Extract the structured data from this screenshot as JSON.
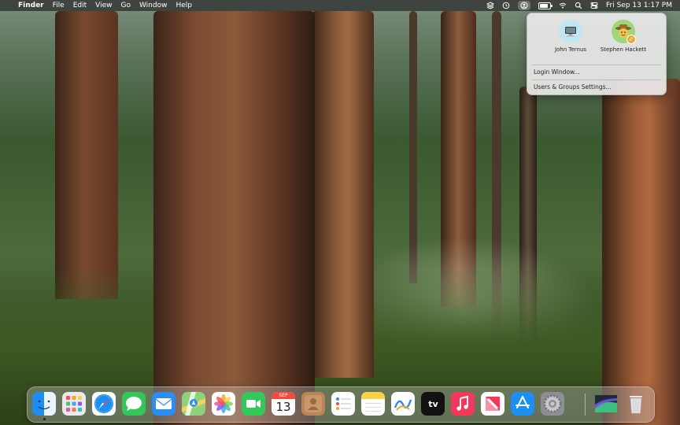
{
  "menubar": {
    "apple": "",
    "app_name": "Finder",
    "menus": [
      "File",
      "Edit",
      "View",
      "Go",
      "Window",
      "Help"
    ],
    "status_icons": [
      "layers-icon",
      "time-machine-icon",
      "user-switch-icon",
      "battery-icon",
      "wifi-icon",
      "spotlight-search-icon",
      "control-center-icon"
    ],
    "battery_level": 0.8,
    "datetime": "Fri Sep 13  1:17 PM"
  },
  "user_menu": {
    "users": [
      {
        "name": "John Ternus",
        "avatar": "computer-avatar-icon"
      },
      {
        "name": "Stephen Hackett",
        "avatar": "cowboy-avatar-icon",
        "logged_in": true
      }
    ],
    "items": [
      "Login Window...",
      "Users & Groups Settings..."
    ]
  },
  "dock": {
    "apps": [
      "Finder",
      "Launchpad",
      "Safari",
      "Messages",
      "Mail",
      "Maps",
      "Photos",
      "FaceTime",
      "Calendar",
      "Contacts",
      "Reminders",
      "Notes",
      "Freeform",
      "TV",
      "Music",
      "News",
      "App Store",
      "System Settings"
    ],
    "calendar": {
      "month": "SEP",
      "day": "13"
    },
    "tv_label": "tv",
    "extras": [
      "Downloads",
      "Trash"
    ]
  }
}
